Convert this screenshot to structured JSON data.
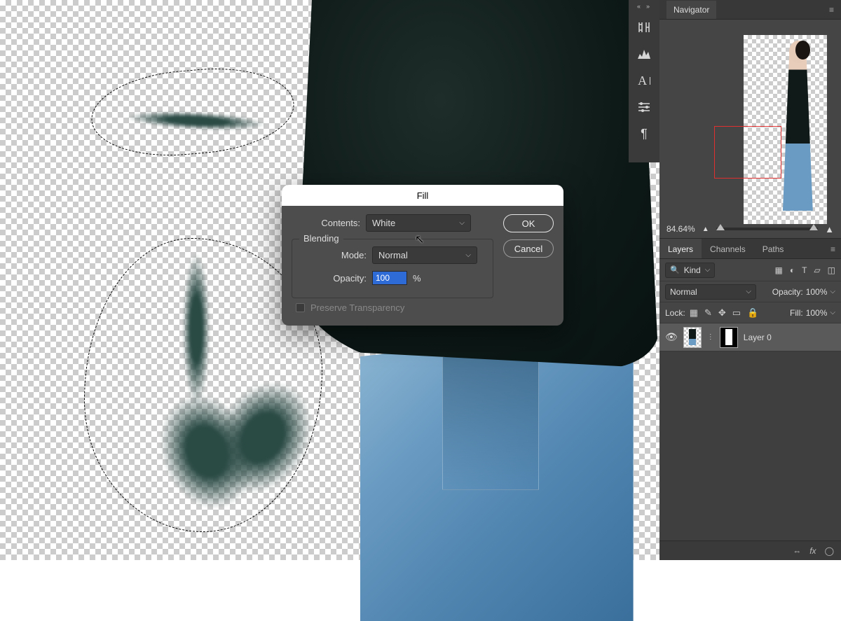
{
  "dialog": {
    "title": "Fill",
    "contents_label": "Contents:",
    "contents_value": "White",
    "blending_legend": "Blending",
    "mode_label": "Mode:",
    "mode_value": "Normal",
    "opacity_label": "Opacity:",
    "opacity_value": "100",
    "opacity_suffix": "%",
    "preserve_label": "Preserve Transparency",
    "ok": "OK",
    "cancel": "Cancel"
  },
  "iconstrip": {
    "close": "«",
    "expand": "»"
  },
  "navigator": {
    "tab": "Navigator",
    "zoom": "84.64%"
  },
  "layersPanel": {
    "tabs": {
      "layers": "Layers",
      "channels": "Channels",
      "paths": "Paths"
    },
    "kind_label": "Kind",
    "blend_mode": "Normal",
    "opacity_label": "Opacity:",
    "opacity_value": "100%",
    "lock_label": "Lock:",
    "fill_label": "Fill:",
    "fill_value": "100%",
    "layer0": "Layer 0",
    "footer": {
      "link": "⇔",
      "fx": "fx",
      "mask": "◯",
      "adj": "◐",
      "group": "▭",
      "new": "⊞",
      "trash": "🗑"
    }
  }
}
